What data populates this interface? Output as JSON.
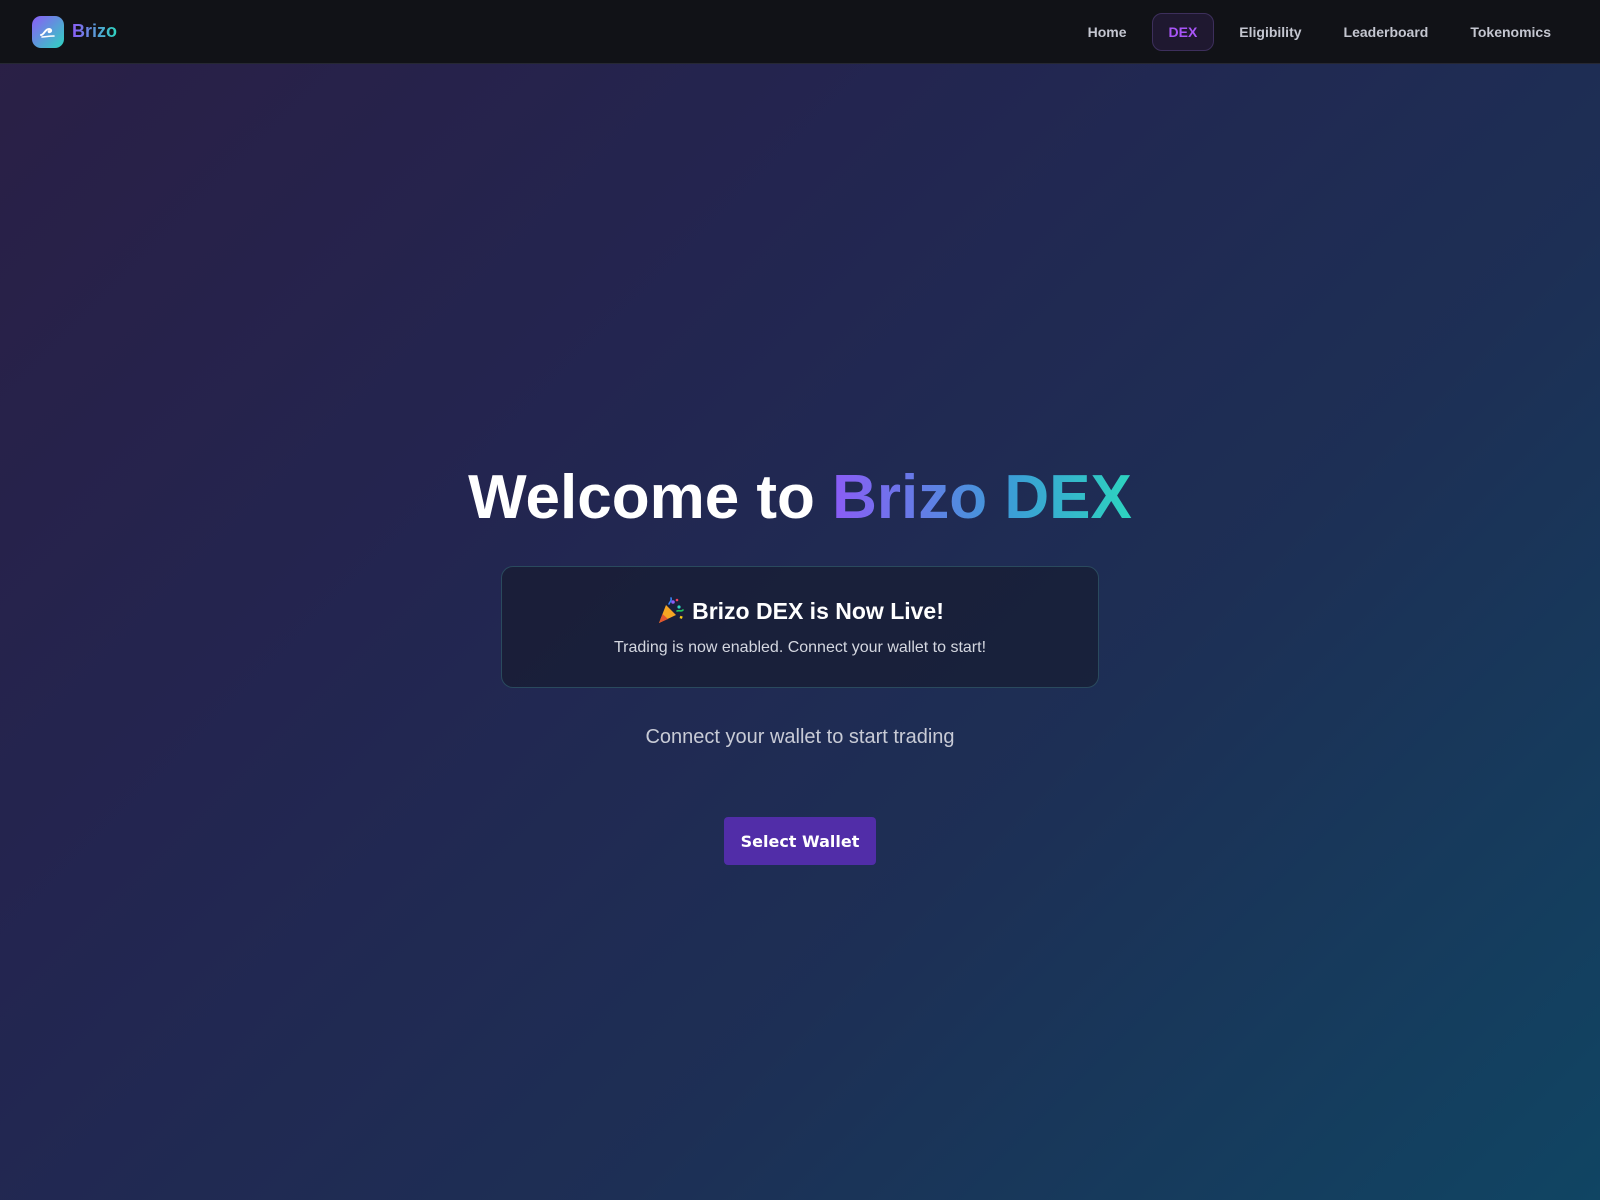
{
  "brand": {
    "name": "Brizo",
    "logo_icon": "wave-icon"
  },
  "nav": {
    "items": [
      {
        "label": "Home",
        "active": false
      },
      {
        "label": "DEX",
        "active": true
      },
      {
        "label": "Eligibility",
        "active": false
      },
      {
        "label": "Leaderboard",
        "active": false
      },
      {
        "label": "Tokenomics",
        "active": false
      }
    ]
  },
  "hero": {
    "title_prefix": "Welcome to ",
    "title_highlight": "Brizo DEX"
  },
  "notice": {
    "icon": "party-popper-icon",
    "title": "Brizo DEX is Now Live!",
    "text": "Trading is now enabled. Connect your wallet to start!"
  },
  "connect": {
    "text": "Connect your wallet to start trading",
    "button_label": "Select Wallet"
  },
  "colors": {
    "accent_purple": "#8b5cf6",
    "accent_teal": "#2dd4bf",
    "button": "#512da8",
    "nav_bg": "#111217"
  }
}
